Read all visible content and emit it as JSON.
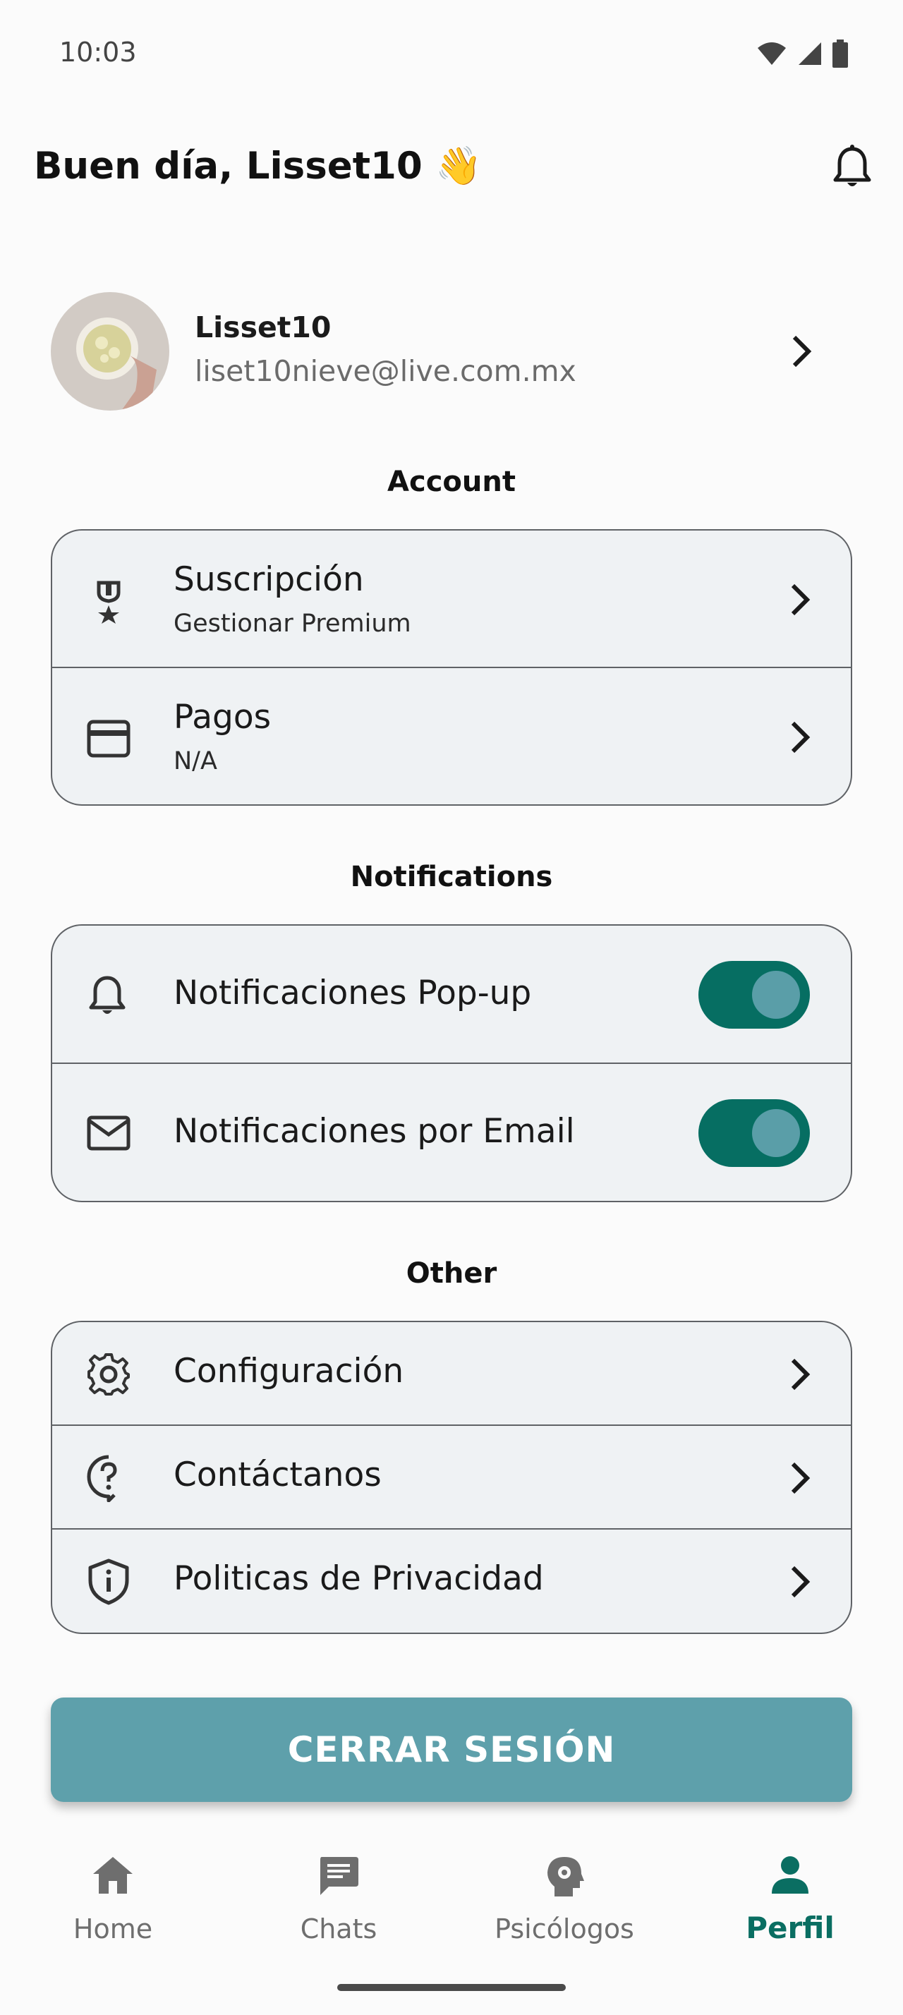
{
  "status_bar": {
    "time": "10:03"
  },
  "header": {
    "greeting": "Buen día, Lisset10 👋"
  },
  "profile": {
    "name": "Lisset10",
    "email": "liset10nieve@live.com.mx"
  },
  "sections": {
    "account": {
      "title": "Account",
      "items": [
        {
          "label": "Suscripción",
          "subtitle": "Gestionar Premium",
          "icon": "medal-icon"
        },
        {
          "label": "Pagos",
          "subtitle": "N/A",
          "icon": "credit-card-icon"
        }
      ]
    },
    "notifications": {
      "title": "Notifications",
      "items": [
        {
          "label": "Notificaciones Pop-up",
          "icon": "bell-icon",
          "enabled": true
        },
        {
          "label": "Notificaciones por Email",
          "icon": "mail-icon",
          "enabled": true
        }
      ]
    },
    "other": {
      "title": "Other",
      "items": [
        {
          "label": "Configuración",
          "icon": "gear-icon"
        },
        {
          "label": "Contáctanos",
          "icon": "help-circle-icon"
        },
        {
          "label": "Politicas de Privacidad",
          "icon": "shield-icon"
        }
      ]
    }
  },
  "logout": {
    "label": "CERRAR SESIÓN"
  },
  "bottom_nav": {
    "items": [
      {
        "label": "Home",
        "icon": "home-icon"
      },
      {
        "label": "Chats",
        "icon": "chat-icon"
      },
      {
        "label": "Psicólogos",
        "icon": "head-gear-icon"
      },
      {
        "label": "Perfil",
        "icon": "person-icon",
        "active": true
      }
    ]
  },
  "colors": {
    "accent": "#066e62",
    "button": "#5ea0ab",
    "card_bg": "#eff2f4"
  }
}
